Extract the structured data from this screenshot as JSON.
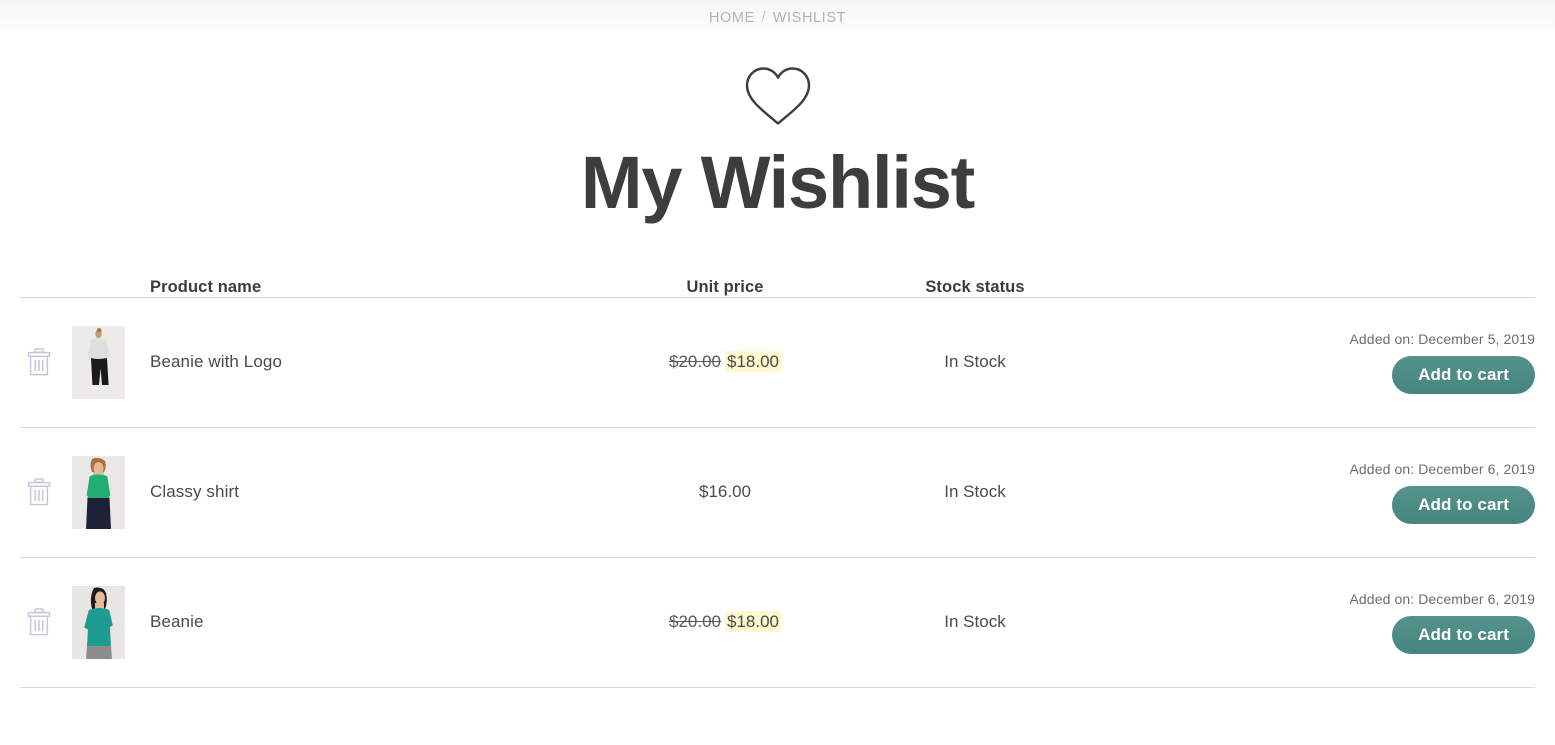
{
  "breadcrumb": {
    "home_label": "HOME",
    "separator": "/",
    "current_label": "WISHLIST"
  },
  "page": {
    "icon": "heart-icon",
    "title": "My Wishlist"
  },
  "table": {
    "headers": {
      "product_name": "Product name",
      "unit_price": "Unit price",
      "stock_status": "Stock status"
    },
    "rows": [
      {
        "remove_icon": "trash-icon",
        "thumbnail": "woman-white-top-black-pants",
        "name": "Beanie with Logo",
        "price_old": "$20.00",
        "price_new": "$18.00",
        "price_on_sale": true,
        "stock_status": "In Stock",
        "added_on": "Added on: December 5, 2019",
        "add_to_cart_label": "Add to cart",
        "show_added_on": false
      },
      {
        "remove_icon": "trash-icon",
        "thumbnail": "woman-green-shirt-navy-pants",
        "name": "Classy shirt",
        "price_old": "",
        "price_new": "$16.00",
        "price_on_sale": false,
        "stock_status": "In Stock",
        "added_on": "Added on: December 6, 2019",
        "add_to_cart_label": "Add to cart",
        "show_added_on": true
      },
      {
        "remove_icon": "trash-icon",
        "thumbnail": "woman-teal-tee-gray-skirt",
        "name": "Beanie",
        "price_old": "$20.00",
        "price_new": "$18.00",
        "price_on_sale": true,
        "stock_status": "In Stock",
        "added_on": "Added on: December 6, 2019",
        "add_to_cart_label": "Add to cart",
        "show_added_on": true
      }
    ],
    "row_one_added_on": "Added on: December 5, 2019"
  },
  "colors": {
    "accent_button": "#4c8a84",
    "sale_highlight": "#fdf8cf",
    "title": "#3d3d3d",
    "breadcrumb_text": "#b3b3b3",
    "divider": "#d9d9d9"
  }
}
